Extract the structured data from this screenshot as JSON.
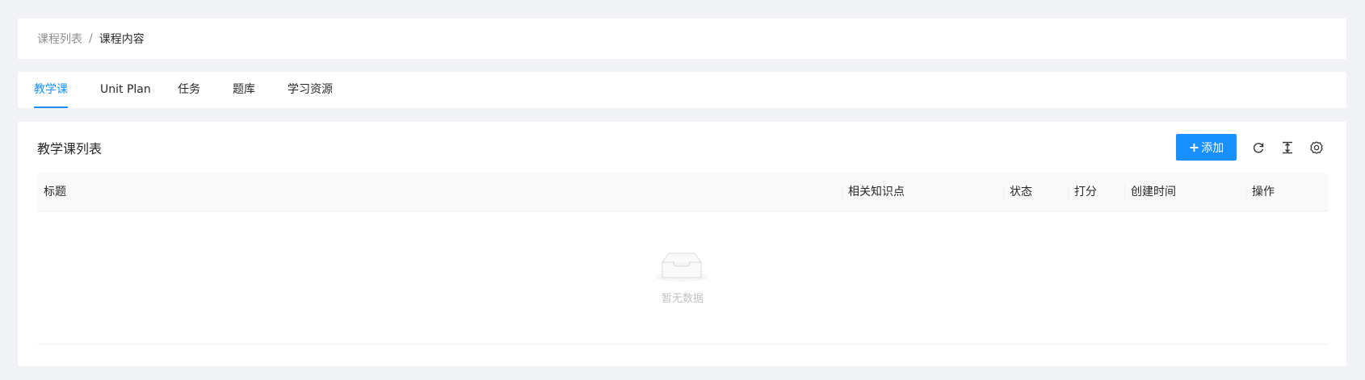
{
  "breadcrumb": {
    "items": [
      {
        "label": "课程列表"
      },
      {
        "label": "课程内容"
      }
    ],
    "separator": "/"
  },
  "tabs": [
    {
      "label": "教学课",
      "active": true
    },
    {
      "label": "Unit Plan",
      "active": false
    },
    {
      "label": "任务",
      "active": false
    },
    {
      "label": "题库",
      "active": false
    },
    {
      "label": "学习资源",
      "active": false
    }
  ],
  "card": {
    "title": "教学课列表",
    "add_button": {
      "label": "添加"
    },
    "tools": {
      "reload": "reload-icon",
      "density": "column-height-icon",
      "settings": "setting-icon"
    }
  },
  "table": {
    "columns": [
      "标题",
      "相关知识点",
      "状态",
      "打分",
      "创建时间",
      "操作"
    ],
    "rows": [],
    "empty_text": "暂无数据"
  },
  "colors": {
    "primary": "#1890ff",
    "background": "#f0f2f5"
  }
}
